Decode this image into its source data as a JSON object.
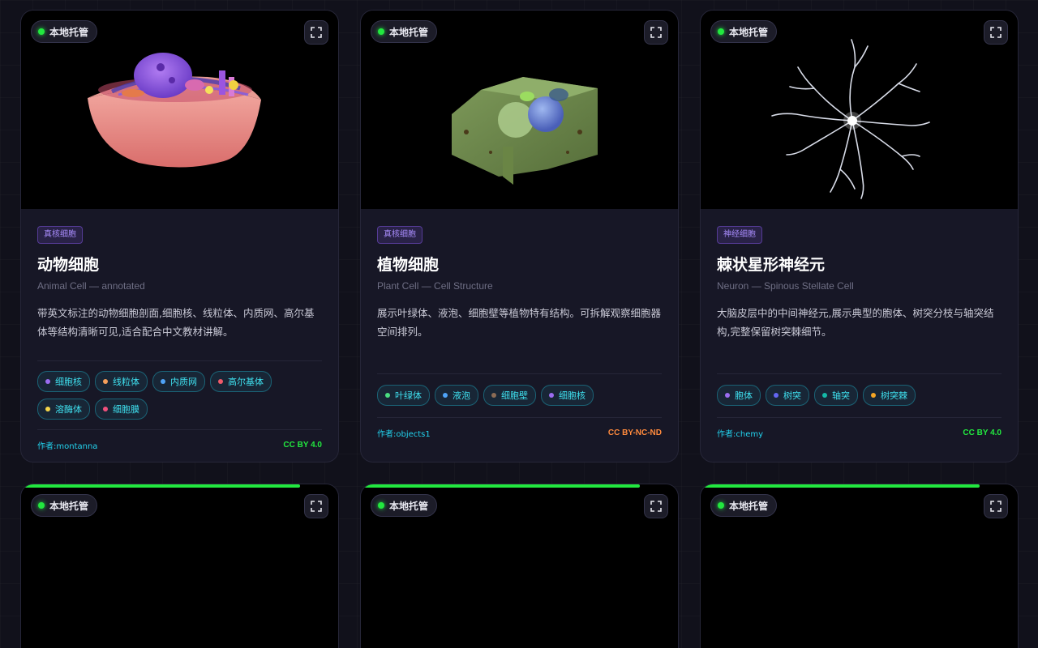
{
  "host_badge": "本地托管",
  "colors": {
    "accent_green": "#22e83f",
    "tag_purple": "#a78bfa",
    "chip_cyan": "#3fe0ef",
    "license_orange": "#ff8a3d"
  },
  "cards": [
    {
      "tag": "真核细胞",
      "title": "动物细胞",
      "subtitle": "Animal Cell — annotated",
      "description": "带英文标注的动物细胞剖面,细胞核、线粒体、内质网、高尔基体等结构清晰可见,适合配合中文教材讲解。",
      "chips": [
        {
          "label": "细胞核",
          "color": "#9b6cf0"
        },
        {
          "label": "线粒体",
          "color": "#f59e5b"
        },
        {
          "label": "内质网",
          "color": "#4fa3f7"
        },
        {
          "label": "高尔基体",
          "color": "#f05a6a"
        },
        {
          "label": "溶酶体",
          "color": "#f5d54a"
        },
        {
          "label": "细胞膜",
          "color": "#f0507c"
        }
      ],
      "author": "作者:montanna",
      "license": "CC BY 4.0"
    },
    {
      "tag": "真核细胞",
      "title": "植物细胞",
      "subtitle": "Plant Cell — Cell Structure",
      "description": "展示叶绿体、液泡、细胞壁等植物特有结构。可拆解观察细胞器空间排列。",
      "chips": [
        {
          "label": "叶绿体",
          "color": "#4ade80"
        },
        {
          "label": "液泡",
          "color": "#4fa3f7"
        },
        {
          "label": "细胞壁",
          "color": "#8b6b55"
        },
        {
          "label": "细胞核",
          "color": "#9b6cf0"
        }
      ],
      "author": "作者:objects1",
      "license": "CC BY-NC-ND"
    },
    {
      "tag": "神经细胞",
      "title": "棘状星形神经元",
      "subtitle": "Neuron — Spinous Stellate Cell",
      "description": "大脑皮层中的中间神经元,展示典型的胞体、树突分枝与轴突结构,完整保留树突棘细节。",
      "chips": [
        {
          "label": "胞体",
          "color": "#9b6cf0"
        },
        {
          "label": "树突",
          "color": "#6366f1"
        },
        {
          "label": "轴突",
          "color": "#14b8a6"
        },
        {
          "label": "树突棘",
          "color": "#f5a524"
        }
      ],
      "author": "作者:chemy",
      "license": "CC BY 4.0"
    }
  ],
  "loading_cards": [
    {
      "progress": 0.88
    },
    {
      "progress": 0.88
    },
    {
      "progress": 0.88
    }
  ]
}
